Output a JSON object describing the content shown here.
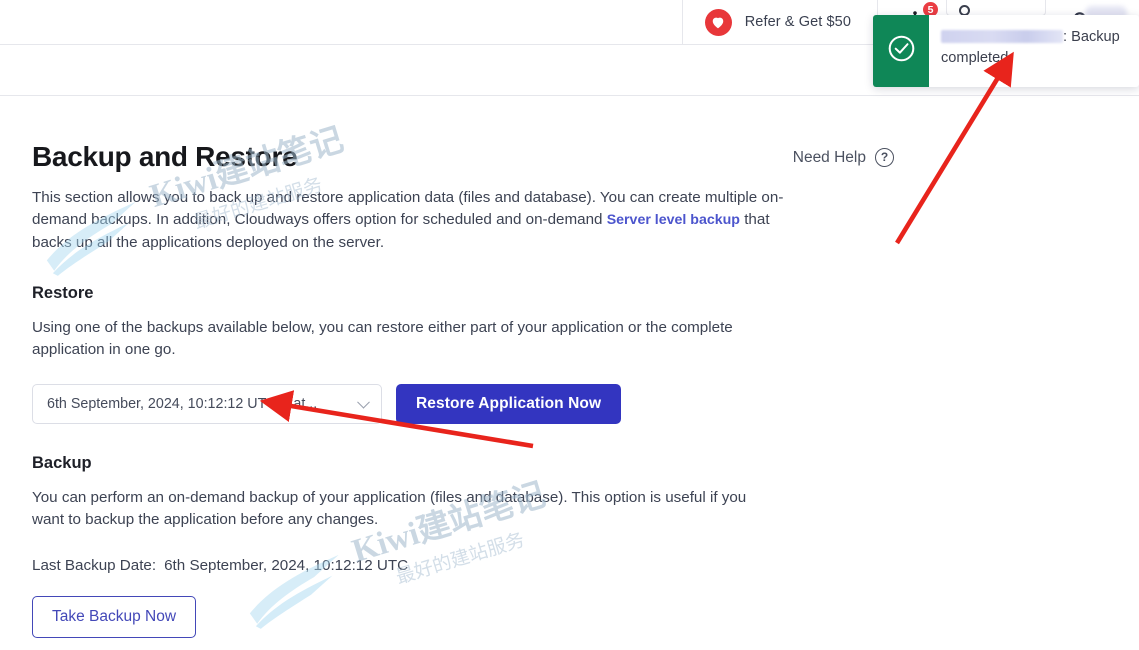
{
  "topbar": {
    "refer_label": "Refer & Get $50",
    "heart_icon": "heart-icon",
    "bot_icon": "bot-icon",
    "bot_badge_count": "5",
    "megaphone_icon": "megaphone-icon",
    "search_icon": "search-icon"
  },
  "toast": {
    "check_icon": "check-circle-icon",
    "redacted_label": "",
    "message_suffix": ": Backup completed"
  },
  "page": {
    "title": "Backup and Restore",
    "need_help_label": "Need Help",
    "help_icon": "question-circle-icon",
    "intro_part1": "This section allows you to back up and restore application data (files and database). You can create multiple on-demand backups. In addition, Cloudways offers option for scheduled and on-demand ",
    "intro_link": "Server level backup",
    "intro_part2": " that backs up all the applications deployed on the server."
  },
  "restore": {
    "heading": "Restore",
    "description": "Using one of the backups available below, you can restore either part of your application or the complete application in one go.",
    "selected_backup": "6th September, 2024, 10:12:12 UTC (Lat...",
    "chevron_icon": "chevron-down-icon",
    "restore_button": "Restore Application Now"
  },
  "backup": {
    "heading": "Backup",
    "description": "You can perform an on-demand backup of your application (files and database). This option is useful if you want to backup the application before any changes.",
    "last_backup_label": "Last Backup Date:",
    "last_backup_value": "6th September, 2024, 10:12:12 UTC",
    "take_backup_button": "Take Backup Now"
  },
  "watermark": {
    "brand": "Kiwi建站笔记",
    "tagline": "最好的建站服务"
  },
  "colors": {
    "primary_button": "#3335c0",
    "link": "#4c55cd",
    "toast_accent": "#0f8757",
    "badge_red": "#ea3d43",
    "heart_red": "#e8373a",
    "annotation_arrow": "#e8241c"
  }
}
